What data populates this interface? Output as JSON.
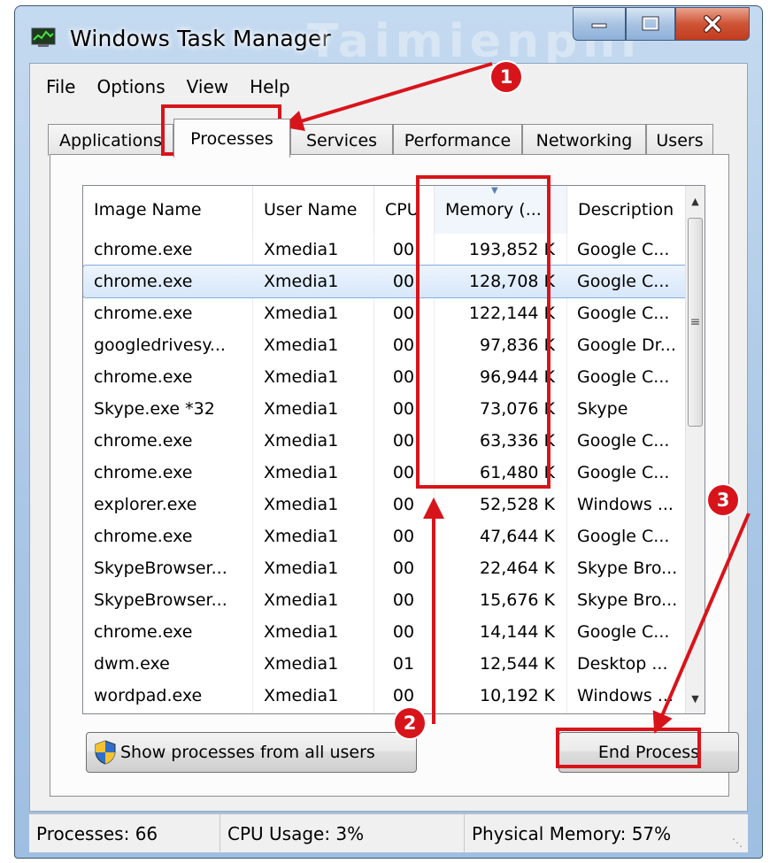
{
  "window": {
    "title": "Windows Task Manager",
    "watermark": "Taimienphi",
    "controls": {
      "minimize_icon": "minimize-icon",
      "maximize_icon": "maximize-icon",
      "close_icon": "close-icon"
    }
  },
  "menu": {
    "items": [
      "File",
      "Options",
      "View",
      "Help"
    ]
  },
  "tabs": [
    {
      "label": "Applications"
    },
    {
      "label": "Processes",
      "active": true
    },
    {
      "label": "Services"
    },
    {
      "label": "Performance"
    },
    {
      "label": "Networking"
    },
    {
      "label": "Users"
    }
  ],
  "table": {
    "columns": [
      "Image Name",
      "User Name",
      "CPU",
      "Memory (...",
      "Description"
    ],
    "sorted_column": "Memory (...",
    "rows": [
      [
        "chrome.exe",
        "Xmedia1",
        "00",
        "193,852 K",
        "Google C..."
      ],
      [
        "chrome.exe",
        "Xmedia1",
        "00",
        "128,708 K",
        "Google C..."
      ],
      [
        "chrome.exe",
        "Xmedia1",
        "00",
        "122,144 K",
        "Google C..."
      ],
      [
        "googledrivesy...",
        "Xmedia1",
        "00",
        "97,836 K",
        "Google Dr..."
      ],
      [
        "chrome.exe",
        "Xmedia1",
        "00",
        "96,944 K",
        "Google C..."
      ],
      [
        "Skype.exe *32",
        "Xmedia1",
        "00",
        "73,076 K",
        "Skype"
      ],
      [
        "chrome.exe",
        "Xmedia1",
        "00",
        "63,336 K",
        "Google C..."
      ],
      [
        "chrome.exe",
        "Xmedia1",
        "00",
        "61,480 K",
        "Google C..."
      ],
      [
        "explorer.exe",
        "Xmedia1",
        "00",
        "52,528 K",
        "Windows ..."
      ],
      [
        "chrome.exe",
        "Xmedia1",
        "00",
        "47,644 K",
        "Google C..."
      ],
      [
        "SkypeBrowser...",
        "Xmedia1",
        "00",
        "22,464 K",
        "Skype Bro..."
      ],
      [
        "SkypeBrowser...",
        "Xmedia1",
        "00",
        "15,676 K",
        "Skype Bro..."
      ],
      [
        "chrome.exe",
        "Xmedia1",
        "00",
        "14,144 K",
        "Google C..."
      ],
      [
        "dwm.exe",
        "Xmedia1",
        "01",
        "12,544 K",
        "Desktop ..."
      ],
      [
        "wordpad.exe",
        "Xmedia1",
        "00",
        "10,192 K",
        "Windows ..."
      ]
    ],
    "selected_row": 1
  },
  "buttons": {
    "show_all": "Show processes from all users",
    "end_process": "End Process"
  },
  "status": {
    "processes": "Processes: 66",
    "cpu": "CPU Usage: 3%",
    "memory": "Physical Memory: 57%"
  },
  "annotations": {
    "badges": [
      "1",
      "2",
      "3"
    ],
    "color": "#d8141b"
  },
  "colors": {
    "accent": "#d8141b",
    "selection": "#d7e7fb",
    "titlebar": "#a9c6e5"
  }
}
